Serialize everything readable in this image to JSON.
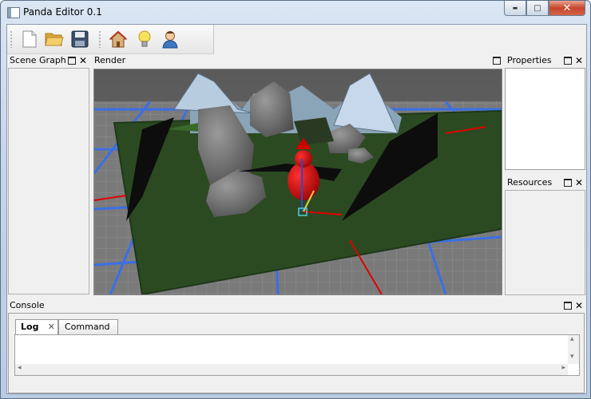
{
  "window": {
    "title": "Panda Editor 0.1"
  },
  "title_buttons": {
    "minimize": "▬",
    "maximize": "□",
    "close": "✕"
  },
  "toolbar": {
    "items": [
      "new-file-icon",
      "open-folder-icon",
      "save-icon",
      "home-icon",
      "lightbulb-icon",
      "user-icon"
    ]
  },
  "panels": {
    "scene_graph": {
      "title": "Scene Graph"
    },
    "render": {
      "title": "Render"
    },
    "properties": {
      "title": "Properties"
    },
    "resources": {
      "title": "Resources"
    },
    "console": {
      "title": "Console"
    }
  },
  "console_tabs": [
    {
      "label": "Log",
      "active": true,
      "closable": true
    },
    {
      "label": "Command",
      "active": false,
      "closable": false
    }
  ],
  "scrollbar_glyphs": {
    "up": "▴",
    "down": "▾",
    "left": "◂",
    "right": "▸"
  },
  "colors": {
    "grid_blue": "#3a6fe6",
    "ground_green": "#2c4a22",
    "gizmo_red": "#e00000"
  }
}
